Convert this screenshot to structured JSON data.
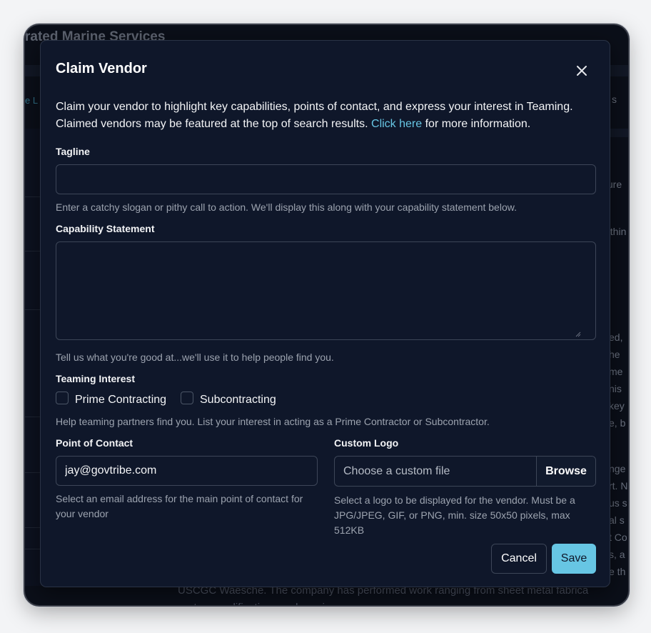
{
  "background": {
    "title_fragment": "rated Marine Services",
    "tab_fragment": "e L",
    "right_fragments": [
      "s",
      "ture",
      "ethin",
      "ed,",
      "he",
      "me",
      "nis",
      "key",
      "e, b",
      "nge",
      "rt. N",
      "us s",
      "al s",
      "t Co",
      "s, a",
      "e th"
    ],
    "bottom_lines": [
      "USCGC Waesche. The company has performed work ranging from sheet metal fabrica",
      "system modifications and repairs."
    ]
  },
  "modal": {
    "title": "Claim Vendor",
    "intro_before_link": "Claim your vendor to highlight key capabilities, points of contact, and express your interest in Teaming. Claimed vendors may be featured at the top of search results. ",
    "intro_link": "Click here",
    "intro_after_link": " for more information.",
    "tagline": {
      "label": "Tagline",
      "value": "",
      "help": "Enter a catchy slogan or pithy call to action. We'll display this along with your capability statement below."
    },
    "capability": {
      "label": "Capability Statement",
      "value": "",
      "help": "Tell us what you're good at...we'll use it to help people find you."
    },
    "teaming": {
      "label": "Teaming Interest",
      "options": [
        {
          "label": "Prime Contracting",
          "checked": false
        },
        {
          "label": "Subcontracting",
          "checked": false
        }
      ],
      "help": "Help teaming partners find you. List your interest in acting as a Prime Contractor or Subcontractor."
    },
    "contact": {
      "label": "Point of Contact",
      "value": "jay@govtribe.com",
      "help": "Select an email address for the main point of contact for your vendor"
    },
    "logo": {
      "label": "Custom Logo",
      "placeholder": "Choose a custom file",
      "browse_label": "Browse",
      "help": "Select a logo to be displayed for the vendor. Must be a JPG/JPEG, GIF, or PNG, min. size 50x50 pixels, max 512KB"
    },
    "buttons": {
      "cancel": "Cancel",
      "save": "Save"
    }
  },
  "colors": {
    "accent": "#67c6e4",
    "modal_bg": "#0f172a",
    "border": "#3d4658"
  }
}
